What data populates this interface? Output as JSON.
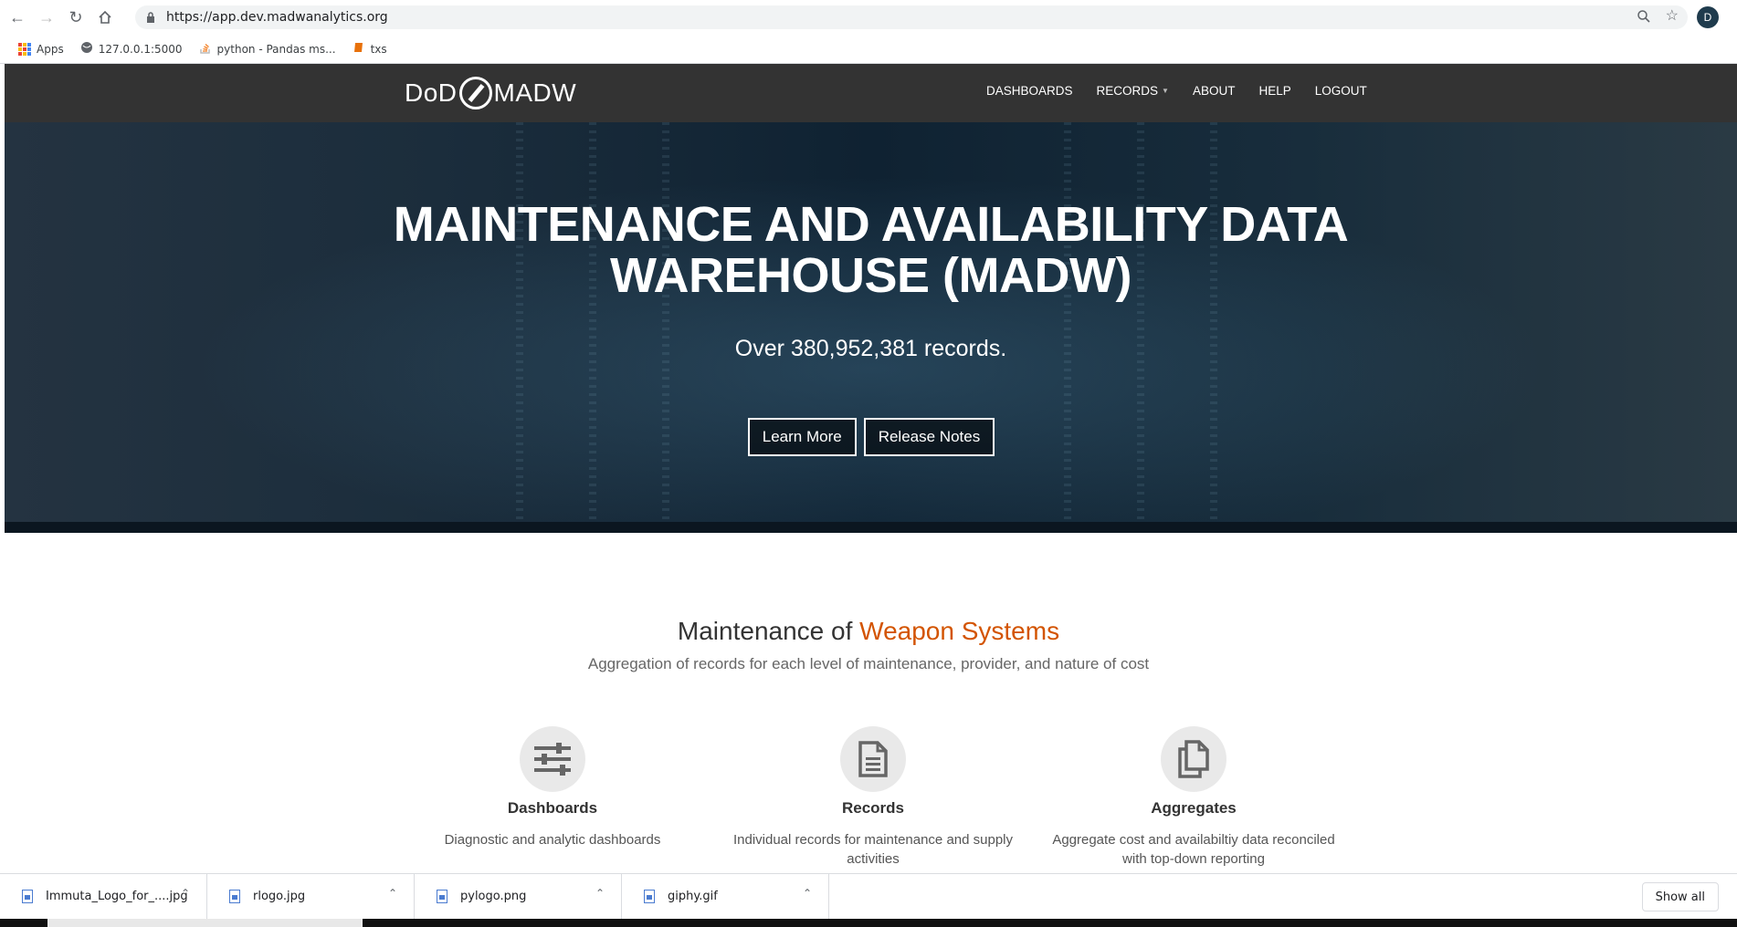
{
  "browser": {
    "url": "https://app.dev.madwanalytics.org",
    "bookmarks": [
      {
        "label": "Apps"
      },
      {
        "label": "127.0.0.1:5000"
      },
      {
        "label": "python - Pandas ms..."
      },
      {
        "label": "txs"
      }
    ],
    "avatar_initial": "D"
  },
  "nav": {
    "logo_left": "DoD",
    "logo_right": "MADW",
    "items": [
      "DASHBOARDS",
      "RECORDS",
      "ABOUT",
      "HELP",
      "LOGOUT"
    ]
  },
  "hero": {
    "title_line1": "MAINTENANCE AND AVAILABILITY DATA",
    "title_line2": "WAREHOUSE (MADW)",
    "record_count": "Over 380,952,381 records.",
    "learn_more": "Learn More",
    "release_notes": "Release Notes"
  },
  "section": {
    "title_part1": "Maintenance of ",
    "title_accent": "Weapon Systems",
    "subtitle": "Aggregation of records for each level of maintenance, provider, and nature of cost",
    "features": [
      {
        "icon": "sliders-icon",
        "title": "Dashboards",
        "desc": "Diagnostic and analytic dashboards"
      },
      {
        "icon": "document-icon",
        "title": "Records",
        "desc": "Individual records for maintenance and supply activities"
      },
      {
        "icon": "copy-icon",
        "title": "Aggregates",
        "desc": "Aggregate cost and availabiltiy data reconciled with top-down reporting"
      }
    ]
  },
  "downloads": {
    "items": [
      "Immuta_Logo_for_....jpg",
      "rlogo.jpg",
      "pylogo.png",
      "giphy.gif"
    ],
    "show_all": "Show all"
  },
  "colors": {
    "accent": "#d35400",
    "navbar": "#333333"
  }
}
